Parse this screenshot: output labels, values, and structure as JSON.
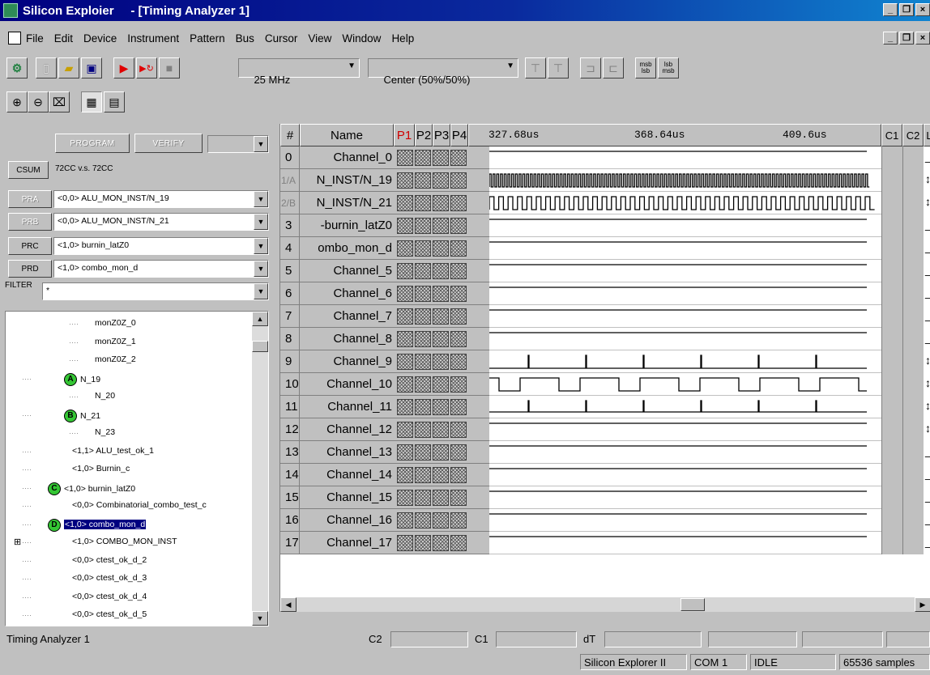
{
  "window": {
    "title": "Silicon Exploier     - [Timing Analyzer 1]",
    "min_label": "_",
    "max_label": "❐",
    "close_label": "×"
  },
  "menu": [
    "File",
    "Edit",
    "Device",
    "Instrument",
    "Pattern",
    "Bus",
    "Cursor",
    "View",
    "Window",
    "Help"
  ],
  "toolbar": {
    "frequency": "25 MHz",
    "trigger_position": "Center (50%/50%)",
    "buttons": [
      "run-icon",
      "step-icon",
      "stop-icon",
      "new-icon",
      "open-icon",
      "save-icon",
      "zoom-in-icon",
      "zoom-out-icon",
      "zoom-fit-icon"
    ],
    "msb_label": "msb lsb",
    "lsb_label": "lsb msb"
  },
  "left_panel": {
    "program_label": "PROGRAM",
    "verify_label": "VERIFY",
    "csum_label": "CSUM",
    "csum_value": "72CC v.s. 72CC",
    "probes": [
      {
        "label": "PRA",
        "value": "<0,0> ALU_MON_INST/N_19",
        "enabled": false
      },
      {
        "label": "PRB",
        "value": "<0,0> ALU_MON_INST/N_21",
        "enabled": false
      },
      {
        "label": "PRC",
        "value": "<1,0> burnin_latZ0",
        "enabled": true
      },
      {
        "label": "PRD",
        "value": "<1,0> combo_mon_d",
        "enabled": true
      }
    ],
    "filter_label": "FILTER",
    "filter_value": "*",
    "tree": [
      {
        "text": "monZ0Z_0",
        "badge": ""
      },
      {
        "text": "monZ0Z_1",
        "badge": ""
      },
      {
        "text": "monZ0Z_2",
        "badge": ""
      },
      {
        "text": "N_19",
        "badge": "A"
      },
      {
        "text": "N_20",
        "badge": ""
      },
      {
        "text": "N_21",
        "badge": "B"
      },
      {
        "text": "N_23",
        "badge": ""
      },
      {
        "text": "<1,1> ALU_test_ok_1",
        "badge": ""
      },
      {
        "text": "<1,0> Burnin_c",
        "badge": ""
      },
      {
        "text": "<1,0> burnin_latZ0",
        "badge": "C"
      },
      {
        "text": "<0,0> Combinatorial_combo_test_c",
        "badge": ""
      },
      {
        "text": "<1,0> combo_mon_d",
        "badge": "D"
      },
      {
        "text": "<1,0> COMBO_MON_INST",
        "badge": ""
      },
      {
        "text": "<0,0> ctest_ok_d_2",
        "badge": ""
      },
      {
        "text": "<0,0> ctest_ok_d_3",
        "badge": ""
      },
      {
        "text": "<0,0> ctest_ok_d_4",
        "badge": ""
      },
      {
        "text": "<0,0> ctest_ok_d_5",
        "badge": ""
      }
    ]
  },
  "grid": {
    "headers": {
      "num": "#",
      "name": "Name",
      "p1": "P1",
      "p2": "P2",
      "p3": "P3",
      "p4": "P4",
      "c1": "C1",
      "c2": "C2",
      "l": "L"
    },
    "times": [
      "327.68us",
      "368.64us",
      "409.6us"
    ],
    "rows": [
      {
        "num": "0",
        "name": "Channel_0",
        "wave": "flat-high"
      },
      {
        "num": "1/A",
        "name": "N_INST/N_19",
        "wave": "fast"
      },
      {
        "num": "2/B",
        "name": "N_INST/N_21",
        "wave": "medium"
      },
      {
        "num": "3",
        "name": "-burnin_latZ0",
        "wave": "flat-high"
      },
      {
        "num": "4",
        "name": "ombo_mon_d",
        "wave": "flat-high"
      },
      {
        "num": "5",
        "name": "Channel_5",
        "wave": "flat-high"
      },
      {
        "num": "6",
        "name": "Channel_6",
        "wave": "flat-high"
      },
      {
        "num": "7",
        "name": "Channel_7",
        "wave": "flat-high"
      },
      {
        "num": "8",
        "name": "Channel_8",
        "wave": "flat-high"
      },
      {
        "num": "9",
        "name": "Channel_9",
        "wave": "pulses"
      },
      {
        "num": "10",
        "name": "Channel_10",
        "wave": "square"
      },
      {
        "num": "11",
        "name": "Channel_11",
        "wave": "pulses-low"
      },
      {
        "num": "12",
        "name": "Channel_12",
        "wave": "flat-high"
      },
      {
        "num": "13",
        "name": "Channel_13",
        "wave": "flat-high"
      },
      {
        "num": "14",
        "name": "Channel_14",
        "wave": "flat-high"
      },
      {
        "num": "15",
        "name": "Channel_15",
        "wave": "flat-high"
      },
      {
        "num": "16",
        "name": "Channel_16",
        "wave": "flat-high"
      },
      {
        "num": "17",
        "name": "Channel_17",
        "wave": "flat-high"
      }
    ],
    "l_marks": [
      "_",
      "↕",
      "↕",
      "_",
      "_",
      "_",
      "_",
      "_",
      "_",
      "↕",
      "↕",
      "↕",
      "↕",
      "_",
      "_",
      "_",
      "_",
      "_"
    ]
  },
  "status": {
    "pane": "Timing Analyzer 1",
    "c2_label": "C2",
    "c1_label": "C1",
    "dt_label": "dT",
    "app": "Silicon Explorer II",
    "port": "COM 1",
    "state": "IDLE",
    "samples": "65536 samples"
  }
}
